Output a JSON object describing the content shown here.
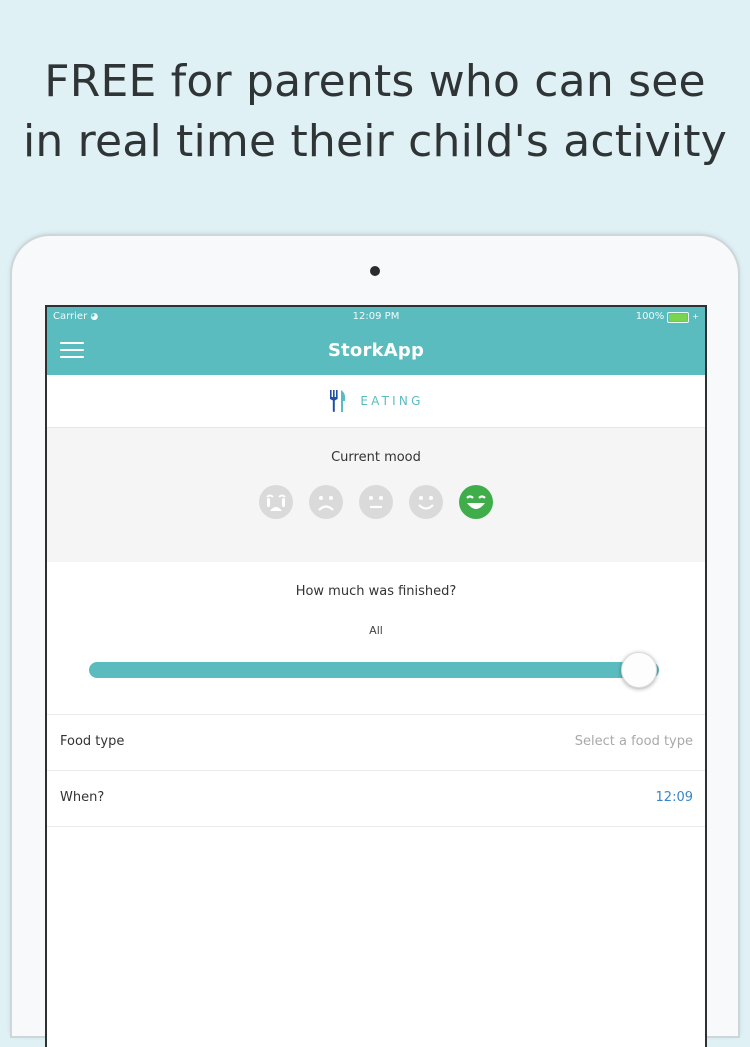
{
  "promo": {
    "line1": "FREE for parents who can see",
    "line2": "in real time their child's activity"
  },
  "status_bar": {
    "carrier": "Carrier",
    "time": "12:09 PM",
    "battery": "100%",
    "battery_level": 1.0
  },
  "navbar": {
    "title": "StorkApp",
    "menu_icon": "hamburger-menu-icon"
  },
  "category": {
    "icon": "fork-knife-icon",
    "label": "EATING",
    "color": "#5bbcbf"
  },
  "mood": {
    "label": "Current mood",
    "options": [
      "crying",
      "sad",
      "neutral",
      "smiling",
      "laughing"
    ],
    "selected_index": 4,
    "selected_color": "#3fae4a",
    "inactive_color": "#dadada"
  },
  "finished": {
    "label": "How much was finished?",
    "value_label": "All",
    "fraction": 1.0
  },
  "form": {
    "food_type": {
      "label": "Food type",
      "placeholder": "Select a food type"
    },
    "when": {
      "label": "When?",
      "value": "12:09"
    }
  },
  "colors": {
    "accent": "#5bbcbf",
    "link": "#3a86c8",
    "background": "#dff1f5"
  }
}
